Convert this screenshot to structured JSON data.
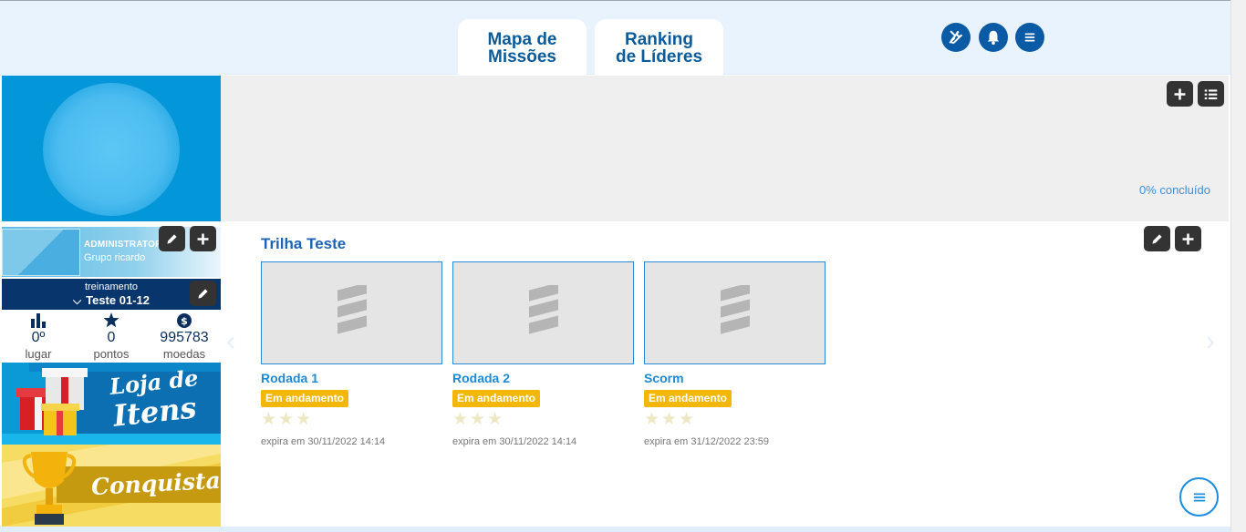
{
  "header": {
    "tabs": [
      {
        "label_line1": "Mapa de",
        "label_line2": "Missões"
      },
      {
        "label_line1": "Ranking",
        "label_line2": "de Líderes"
      }
    ],
    "icons": [
      "tools-icon",
      "bell-icon",
      "menu-icon"
    ]
  },
  "banner": {
    "progress": "0% concluído"
  },
  "profile": {
    "role": "ADMINISTRATOR",
    "group": "Grupo ricardo",
    "training_label": "treinamento",
    "training_name": "Teste 01-12"
  },
  "stats": [
    {
      "value": "0º",
      "label": "lugar",
      "icon": "bar-chart-icon"
    },
    {
      "value": "0",
      "label": "pontos",
      "icon": "star-icon"
    },
    {
      "value": "995783",
      "label": "moedas",
      "icon": "coin-icon"
    }
  ],
  "promos": {
    "loja_line1": "Loja de",
    "loja_line2": "Itens",
    "conquistas": "Conquistas"
  },
  "trail": {
    "title": "Trilha Teste",
    "rounds": [
      {
        "title": "Rodada 1",
        "status": "Em andamento",
        "stars": 3,
        "expires": "expira em 30/11/2022 14:14"
      },
      {
        "title": "Rodada 2",
        "status": "Em andamento",
        "stars": 3,
        "expires": "expira em 30/11/2022 14:14"
      },
      {
        "title": "Scorm",
        "status": "Em andamento",
        "stars": 3,
        "expires": "expira em 31/12/2022 23:59"
      }
    ]
  },
  "colors": {
    "brand": "#0b5aa5",
    "accent": "#1e8ad6",
    "status": "#f3b70a",
    "training_bg": "#08356b"
  }
}
